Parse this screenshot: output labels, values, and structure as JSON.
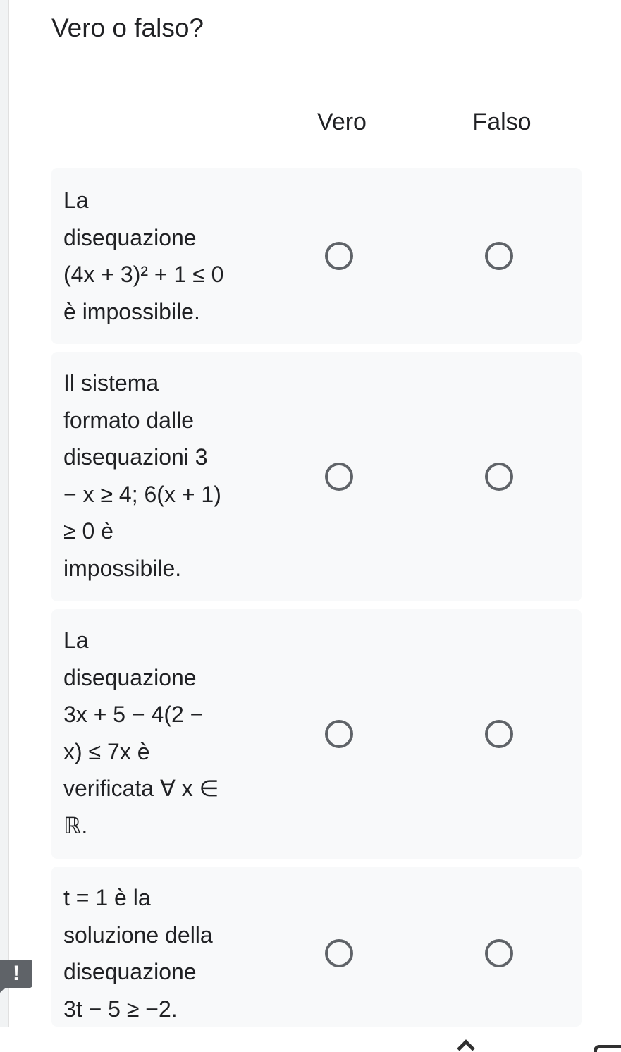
{
  "question": {
    "title": "Vero o falso?"
  },
  "columns": [
    "Vero",
    "Falso"
  ],
  "rows": [
    {
      "label": "La\ndisequazione\n(4x + 3)² + 1 ≤ 0\nè impossibile."
    },
    {
      "label": "Il sistema\nformato dalle\ndisequazioni 3\n− x ≥ 4; 6(x + 1)\n≥ 0 è\nimpossibile."
    },
    {
      "label": "La\ndisequazione\n3x + 5 − 4(2 −\nx) ≤ 7x è\nverificata ∀ x ∈\nℝ."
    },
    {
      "label": "t = 1 è la\nsoluzione della\ndisequazione\n3t − 5 ≥ −2."
    }
  ],
  "alert": {
    "icon": "!"
  },
  "icons": {
    "alert": "exclamation-icon",
    "home": "home-nav-icon",
    "back": "back-nav-icon"
  }
}
